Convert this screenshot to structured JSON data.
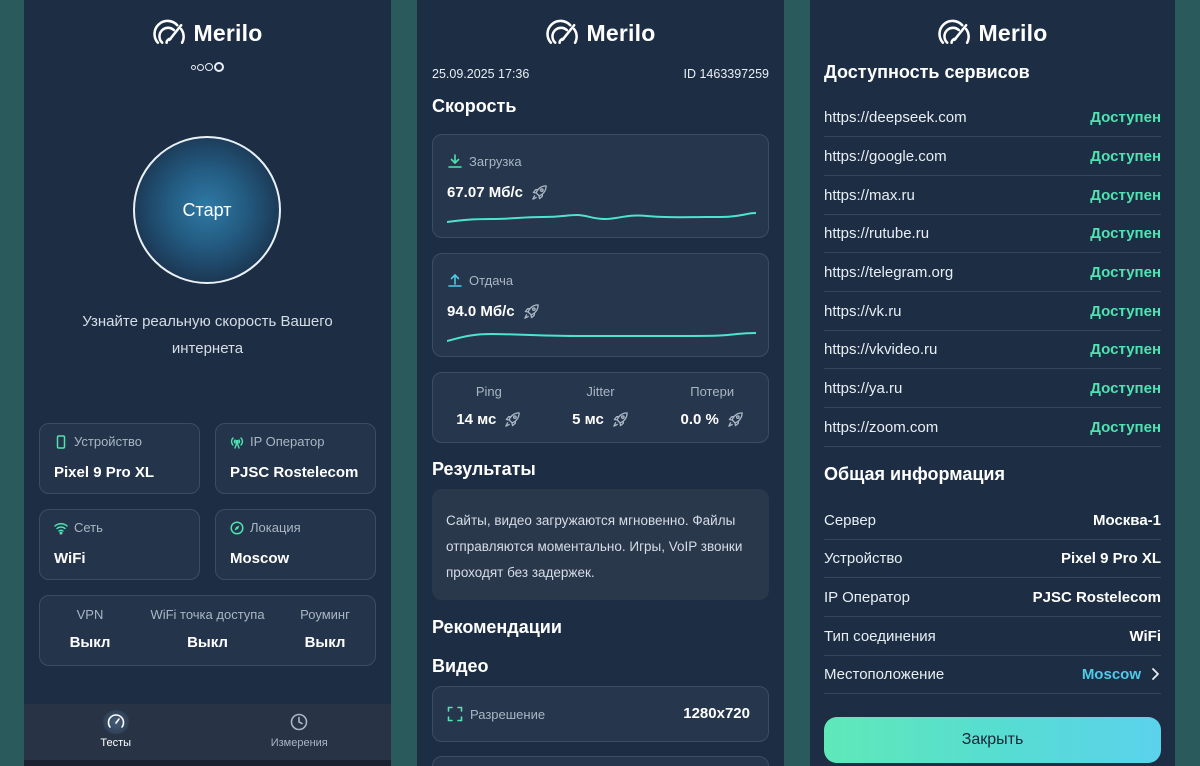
{
  "app": {
    "name": "Merilo"
  },
  "colors": {
    "accent_green": "#4ee3b1",
    "accent_cyan": "#4ec9e8",
    "panel_bg": "#1d2e44"
  },
  "home": {
    "start_label": "Старт",
    "tagline": "Узнайте реальную скорость Вашего интернета",
    "cards": [
      {
        "label": "Устройство",
        "value": "Pixel 9 Pro XL",
        "icon": "phone-icon"
      },
      {
        "label": "IP Оператор",
        "value": "PJSC Rostelecom",
        "icon": "antenna-icon"
      },
      {
        "label": "Сеть",
        "value": "WiFi",
        "icon": "wifi-icon"
      },
      {
        "label": "Локация",
        "value": "Moscow",
        "icon": "compass-icon"
      }
    ],
    "toggles": [
      {
        "label": "VPN",
        "value": "Выкл"
      },
      {
        "label": "WiFi точка доступа",
        "value": "Выкл"
      },
      {
        "label": "Роуминг",
        "value": "Выкл"
      }
    ],
    "tabs": [
      {
        "label": "Тесты",
        "icon": "speedometer-icon",
        "active": true
      },
      {
        "label": "Измерения",
        "icon": "clock-icon",
        "active": false
      }
    ]
  },
  "results": {
    "datetime": "25.09.2025 17:36",
    "id": "ID 1463397259",
    "speed_title": "Скорость",
    "download": {
      "label": "Загрузка",
      "value": "67.07 Мб/с"
    },
    "upload": {
      "label": "Отдача",
      "value": "94.0 Мб/с"
    },
    "stats": [
      {
        "label": "Ping",
        "value": "14 мс"
      },
      {
        "label": "Jitter",
        "value": "5 мс"
      },
      {
        "label": "Потери",
        "value": "0.0 %"
      }
    ],
    "results_title": "Результаты",
    "results_text": "Сайты, видео загружаются мгновенно. Файлы отправляются моментально. Игры, VoIP звонки проходят без задержек.",
    "recommendations_title": "Рекомендации",
    "video_title": "Видео",
    "resolution": {
      "label": "Разрешение",
      "value": "1280x720"
    }
  },
  "services": {
    "title": "Доступность сервисов",
    "items": [
      {
        "url": "https://deepseek.com",
        "status": "Доступен"
      },
      {
        "url": "https://google.com",
        "status": "Доступен"
      },
      {
        "url": "https://max.ru",
        "status": "Доступен"
      },
      {
        "url": "https://rutube.ru",
        "status": "Доступен"
      },
      {
        "url": "https://telegram.org",
        "status": "Доступен"
      },
      {
        "url": "https://vk.ru",
        "status": "Доступен"
      },
      {
        "url": "https://vkvideo.ru",
        "status": "Доступен"
      },
      {
        "url": "https://ya.ru",
        "status": "Доступен"
      },
      {
        "url": "https://zoom.com",
        "status": "Доступен"
      }
    ],
    "info_title": "Общая информация",
    "info": [
      {
        "label": "Сервер",
        "value": "Москва-1"
      },
      {
        "label": "Устройство",
        "value": "Pixel 9 Pro XL"
      },
      {
        "label": "IP Оператор",
        "value": "PJSC Rostelecom"
      },
      {
        "label": "Тип соединения",
        "value": "WiFi"
      },
      {
        "label": "Местоположение",
        "value": "Moscow"
      }
    ],
    "close_label": "Закрыть"
  }
}
